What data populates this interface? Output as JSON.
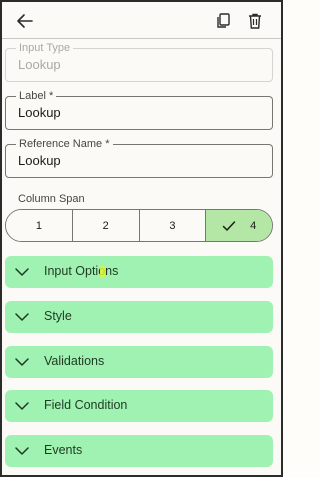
{
  "header": {
    "icons": [
      "arrow-back-icon",
      "copy-icon",
      "trash-icon"
    ]
  },
  "fields": {
    "input_type": {
      "label": "Input Type",
      "value": "Lookup"
    },
    "label": {
      "label": "Label *",
      "value": "Lookup"
    },
    "reference_name": {
      "label": "Reference Name *",
      "value": "Lookup"
    }
  },
  "column_span": {
    "label": "Column Span",
    "options": [
      "1",
      "2",
      "3",
      "4"
    ],
    "selected": "4"
  },
  "sections": [
    {
      "label": "Input Options"
    },
    {
      "label": "Style"
    },
    {
      "label": "Validations"
    },
    {
      "label": "Field Condition"
    },
    {
      "label": "Events"
    }
  ],
  "colors": {
    "accordion_bg": "#9ff2b1",
    "selected_segment": "#b4e6a6"
  }
}
